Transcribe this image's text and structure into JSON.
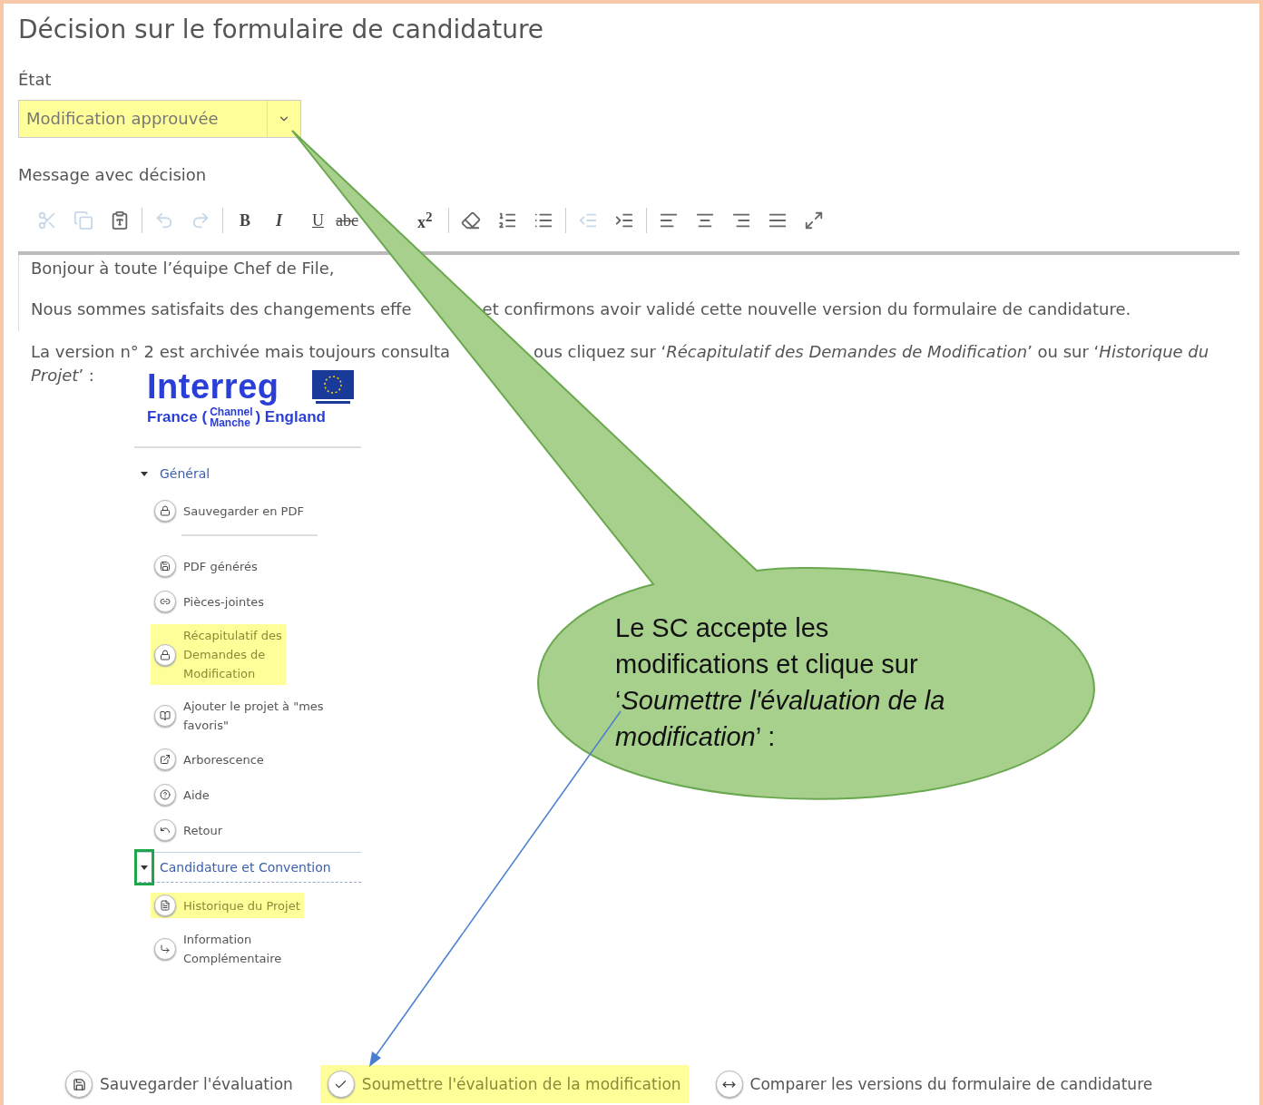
{
  "title": "Décision sur le formulaire de candidature",
  "state_label": "État",
  "state_select": {
    "value": "Modification approuvée",
    "highlighted": true
  },
  "message_label": "Message avec décision",
  "toolbar": [
    {
      "kind": "icon",
      "disabled": true
    },
    {
      "kind": "icon",
      "disabled": true
    },
    {
      "kind": "icon",
      "disabled": false
    },
    {
      "kind": "separator"
    },
    {
      "kind": "icon",
      "disabled": true
    },
    {
      "kind": "icon",
      "disabled": true
    },
    {
      "kind": "separator"
    },
    {
      "kind": "glyph",
      "label": "B"
    },
    {
      "kind": "glyph",
      "label": "I"
    },
    {
      "kind": "glyph",
      "label": "U"
    },
    {
      "kind": "glyph",
      "label": "abc"
    },
    {
      "kind": "glyph",
      "label": "x$^{2}$"
    },
    {
      "kind": "separator"
    },
    {
      "kind": "icon",
      "disabled": false
    },
    {
      "kind": "icon",
      "disabled": false
    },
    {
      "kind": "icon",
      "disabled": false
    },
    {
      "kind": "separator"
    },
    {
      "kind": "icon",
      "disabled": true
    },
    {
      "kind": "icon",
      "disabled": false
    },
    {
      "kind": "separator"
    },
    {
      "kind": "icon",
      "disabled": false
    },
    {
      "kind": "icon",
      "disabled": false
    },
    {
      "kind": "icon",
      "disabled": false
    },
    {
      "kind": "icon",
      "disabled": false
    },
    {
      "kind": "icon",
      "disabled": false
    }
  ],
  "editor_paragraphs": [
    [
      "Bonjour à toute l’équipe Chef de File,"
    ],
    [
      "Nous sommes satisfaits des changements effe",
      "et confirmons avoir validé cette nouvelle version du formulaire de candidature."
    ]
  ],
  "paragraph": [
    [
      "La version n° 2 est archivée mais toujours consulta",
      "ous cliquez sur ‘*Récapitulatif des Demandes de Modification*’ ou sur ‘*Historique du*"
    ],
    [
      "*Projet*’ :"
    ]
  ],
  "logo": {
    "name": "Interreg",
    "left": "France (",
    "top": "Channel",
    "bottom": "Manche",
    "right": ") England"
  },
  "tree": [
    {
      "label": "Général",
      "expanded": true,
      "outlined": false,
      "children": [
        {
          "kind": "item",
          "label": "Sauvegarder en PDF",
          "highlighted": false
        },
        {
          "kind": "separator"
        },
        {
          "kind": "item",
          "label": "PDF générés",
          "highlighted": false
        },
        {
          "kind": "item",
          "label": "Pièces-jointes",
          "highlighted": false
        },
        {
          "kind": "item",
          "label": "Récapitulatif des\nDemandes de\nModification",
          "highlighted": true
        },
        {
          "kind": "item",
          "label": "Ajouter le projet à \"mes\nfavoris\"",
          "highlighted": false
        },
        {
          "kind": "item",
          "label": "Arborescence",
          "highlighted": false
        },
        {
          "kind": "item",
          "label": "Aide",
          "highlighted": false
        },
        {
          "kind": "item",
          "label": "Retour",
          "highlighted": false
        }
      ]
    },
    {
      "label": "Candidature et Convention",
      "expanded": true,
      "outlined": true,
      "children": [
        {
          "kind": "item",
          "label": "Historique du Projet",
          "highlighted": true
        },
        {
          "kind": "item",
          "label": "Information\nComplémentaire",
          "highlighted": false
        }
      ]
    }
  ],
  "buttons": [
    {
      "label": "Sauvegarder l'évaluation",
      "highlighted": false
    },
    {
      "label": "Soumettre l'évaluation de la modification",
      "highlighted": true
    },
    {
      "label": "Comparer les versions du formulaire de candidature",
      "highlighted": false
    }
  ],
  "callout": {
    "text": "Le SC accepte les\nmodifications et clique sur\n‘*Soumettre l'évaluation de la\nmodification*’ :"
  }
}
